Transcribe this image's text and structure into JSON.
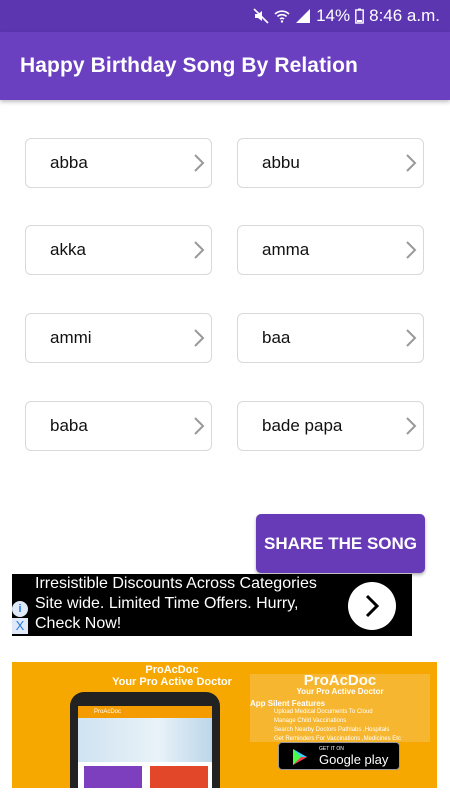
{
  "status_bar": {
    "battery": "14%",
    "time": "8:46 a.m.",
    "icons": [
      "mute-icon",
      "wifi-icon",
      "signal-icon",
      "battery-icon"
    ]
  },
  "app_bar": {
    "title": "Happy Birthday Song By Relation"
  },
  "relations": [
    "abba",
    "abbu",
    "akka",
    "amma",
    "ammi",
    "baa",
    "baba",
    "bade papa"
  ],
  "share_button": {
    "label": "SHARE THE SONG"
  },
  "text_ad": {
    "line1": "Irresistible Discounts Across Categories",
    "line2": "Site wide. Limited Time Offers. Hurry,",
    "line3": "Check Now!",
    "info": "i",
    "close": "X"
  },
  "banner_ad": {
    "brand": "ProAcDoc",
    "tagline": "Your Pro Active Doctor",
    "phone_app": "ProAcDoc",
    "brand2": "ProAcDoc",
    "tagline2": "Your Pro Active Doctor",
    "features_title": "App Silent Features",
    "features": [
      "Upload Medical Documents To Cloud",
      "Manage Child Vaccinations",
      "Search Nearby Doctors Pathlabs ,Hospitals",
      "Get Reminders For Vaccinations ,Medicines Etc"
    ],
    "store_small": "GET IT ON",
    "store_big": "Google play"
  },
  "colors": {
    "status": "#5c35b0",
    "app_bar": "#6a3fc0",
    "button": "#673ab7",
    "banner": "#f7a800"
  }
}
